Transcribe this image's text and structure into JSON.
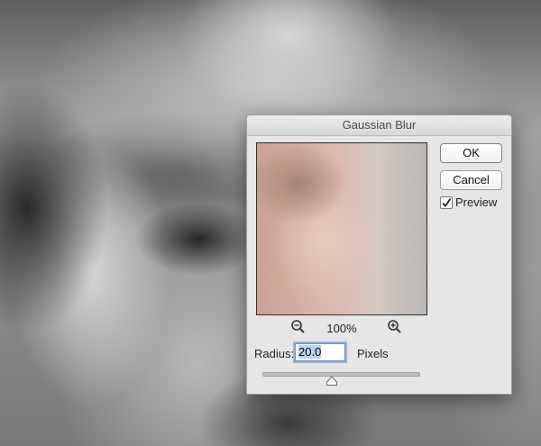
{
  "dialog": {
    "title": "Gaussian Blur",
    "ok_label": "OK",
    "cancel_label": "Cancel",
    "preview_label": "Preview",
    "preview_checked": true,
    "zoom_level": "100%",
    "zoom_out_icon": "zoom-out-icon",
    "zoom_in_icon": "zoom-in-icon",
    "radius_label": "Radius:",
    "radius_value": "20.0",
    "radius_units": "Pixels",
    "radius_slider_fraction": 0.44
  }
}
